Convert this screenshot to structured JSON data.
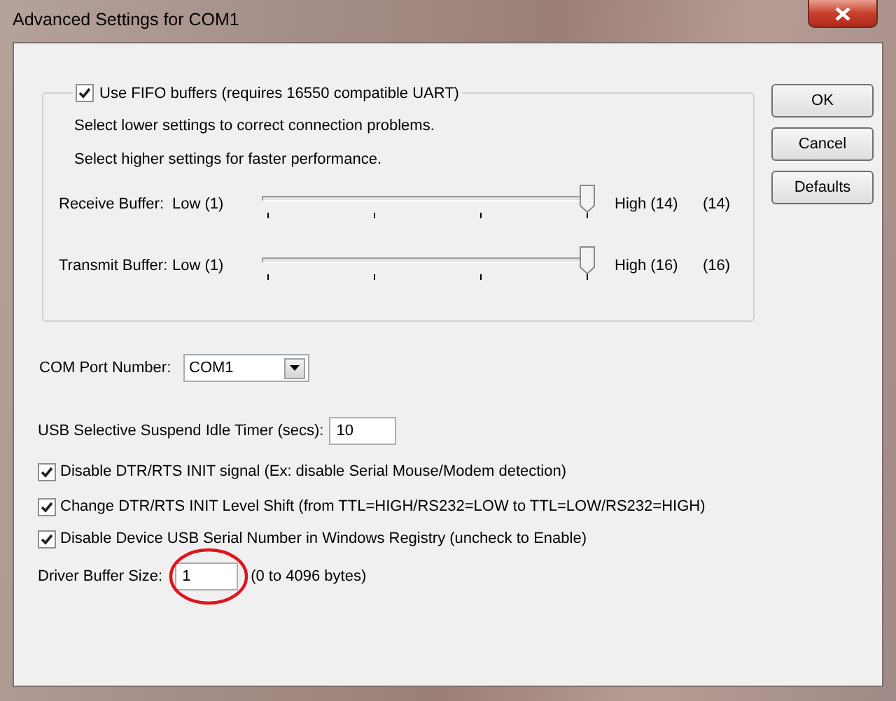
{
  "window": {
    "title": "Advanced Settings for COM1"
  },
  "fifo": {
    "label": "Use FIFO buffers (requires 16550 compatible UART)",
    "checked": true,
    "notes": [
      "Select lower settings to correct connection problems.",
      "Select higher settings for faster performance."
    ],
    "sliders": [
      {
        "label": "Receive Buffer:",
        "low": "Low (1)",
        "high": "High (14)",
        "reading": "(14)",
        "level": 1
      },
      {
        "label": "Transmit Buffer:",
        "low": "Low (1)",
        "high": "High (16)",
        "reading": "(16)",
        "level": 1
      }
    ]
  },
  "com_port": {
    "label": "COM Port Number:",
    "value": "COM1"
  },
  "idle_timer": {
    "label": "USB Selective Suspend Idle Timer (secs):",
    "value": "10"
  },
  "options": [
    {
      "label": "Disable DTR/RTS INIT signal (Ex: disable Serial Mouse/Modem detection)",
      "checked": true
    },
    {
      "label": "Change DTR/RTS INIT Level Shift (from TTL=HIGH/RS232=LOW to TTL=LOW/RS232=HIGH)",
      "checked": true
    },
    {
      "label": "Disable Device USB Serial Number in Windows Registry (uncheck to Enable)",
      "checked": true
    }
  ],
  "driver_buffer": {
    "label": "Driver Buffer Size:",
    "value": "1",
    "hint": "(0 to 4096 bytes)"
  },
  "buttons": [
    "OK",
    "Cancel",
    "Defaults"
  ]
}
